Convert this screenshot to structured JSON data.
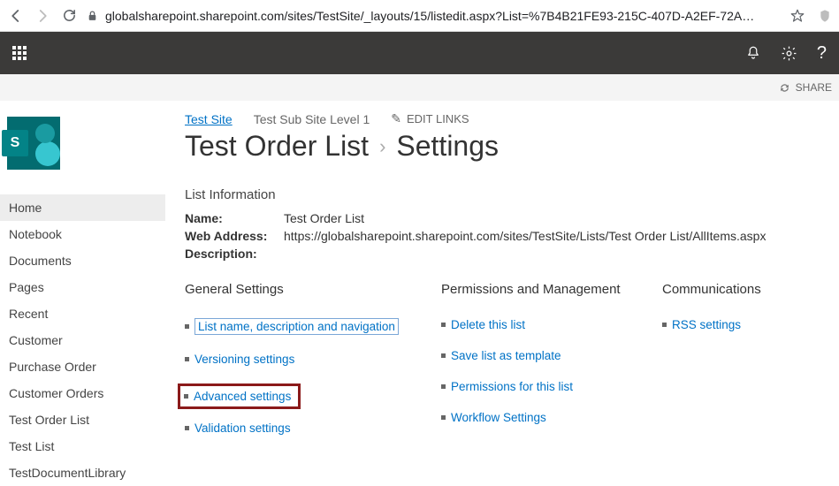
{
  "browser": {
    "url": "globalsharepoint.sharepoint.com/sites/TestSite/_layouts/15/listedit.aspx?List=%7B4B21FE93-215C-407D-A2EF-72A…"
  },
  "share_strip": {
    "share": "SHARE"
  },
  "crumbs": {
    "site": "Test Site",
    "subsite": "Test Sub Site Level 1",
    "edit": "EDIT LINKS"
  },
  "title": {
    "list": "Test Order List",
    "page": "Settings"
  },
  "sidebar": [
    "Home",
    "Notebook",
    "Documents",
    "Pages",
    "Recent",
    "Customer",
    "Purchase Order",
    "Customer Orders",
    "Test Order List",
    "Test List",
    "TestDocumentLibrary"
  ],
  "info": {
    "heading": "List Information",
    "name_lbl": "Name:",
    "name_val": "Test Order List",
    "addr_lbl": "Web Address:",
    "addr_val": "https://globalsharepoint.sharepoint.com/sites/TestSite/Lists/Test Order List/AllItems.aspx",
    "desc_lbl": "Description:"
  },
  "cols": {
    "general": {
      "h": "General Settings",
      "links": [
        "List name, description and navigation",
        "Versioning settings",
        "Advanced settings",
        "Validation settings"
      ]
    },
    "perms": {
      "h": "Permissions and Management",
      "links": [
        "Delete this list",
        "Save list as template",
        "Permissions for this list",
        "Workflow Settings"
      ]
    },
    "comm": {
      "h": "Communications",
      "links": [
        "RSS settings"
      ]
    }
  }
}
